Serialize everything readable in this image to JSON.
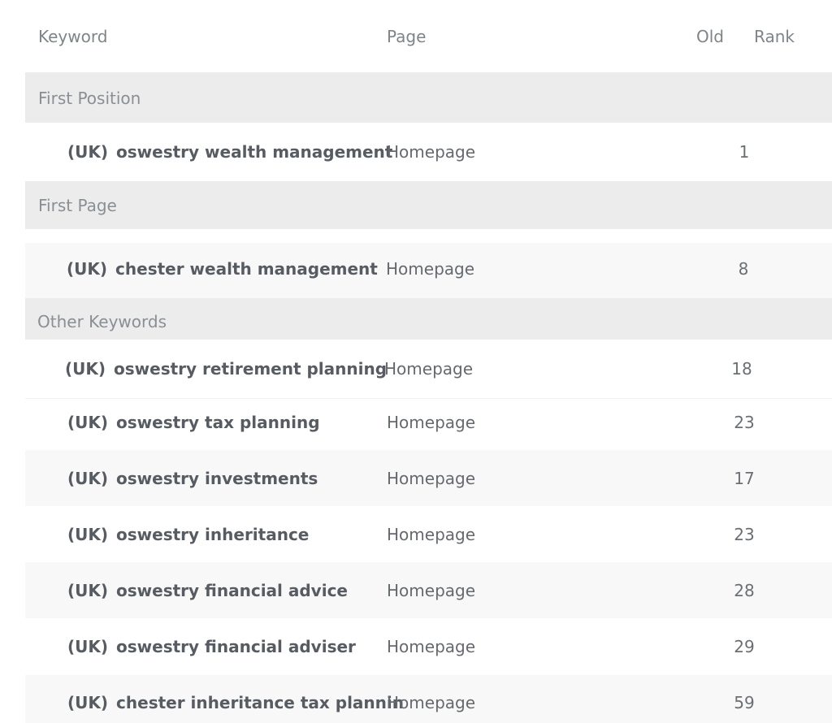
{
  "header": {
    "keyword": "Keyword",
    "page": "Page",
    "old": "Old",
    "rank": "Rank"
  },
  "groups": [
    {
      "label": "First Position",
      "rows": [
        {
          "region": "(UK)",
          "keyword": "oswestry wealth management",
          "page": "Homepage",
          "rank": "1"
        }
      ]
    },
    {
      "label": "First Page",
      "rows": [
        {
          "region": "(UK)",
          "keyword": "chester wealth management",
          "page": "Homepage",
          "rank": "8"
        }
      ]
    },
    {
      "label": "Other Keywords",
      "rows": [
        {
          "region": "(UK)",
          "keyword": "oswestry retirement planning",
          "page": "Homepage",
          "rank": "18"
        },
        {
          "region": "(UK)",
          "keyword": "oswestry tax planning",
          "page": "Homepage",
          "rank": "23"
        },
        {
          "region": "(UK)",
          "keyword": "oswestry investments",
          "page": "Homepage",
          "rank": "17"
        },
        {
          "region": "(UK)",
          "keyword": "oswestry inheritance",
          "page": "Homepage",
          "rank": "23"
        },
        {
          "region": "(UK)",
          "keyword": "oswestry financial advice",
          "page": "Homepage",
          "rank": "28"
        },
        {
          "region": "(UK)",
          "keyword": "oswestry financial adviser",
          "page": "Homepage",
          "rank": "29"
        },
        {
          "region": "(UK)",
          "keyword": "chester inheritance tax plannin",
          "page": "Homepage",
          "rank": "59"
        }
      ]
    }
  ]
}
